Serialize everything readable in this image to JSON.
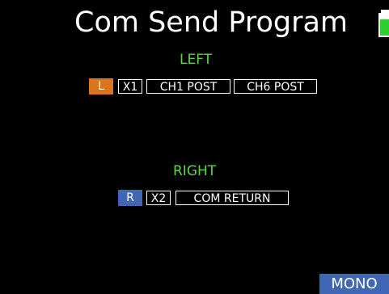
{
  "screen": {
    "title": "Com Send Program",
    "battery_icon": "battery-icon",
    "colors": {
      "background": "#000000",
      "section_label": "#5fd44a",
      "left_selected": "#d9741f",
      "right_selected": "#3f67b5",
      "battery_fill": "#2fcf2f"
    }
  },
  "left": {
    "label": "LEFT",
    "selector": "L",
    "chips": [
      "X1",
      "CH1 POST",
      "CH6 POST"
    ]
  },
  "right": {
    "label": "RIGHT",
    "selector": "R",
    "chips": [
      "X2",
      "COM RETURN"
    ]
  },
  "footer": {
    "mono_label": "MONO"
  }
}
